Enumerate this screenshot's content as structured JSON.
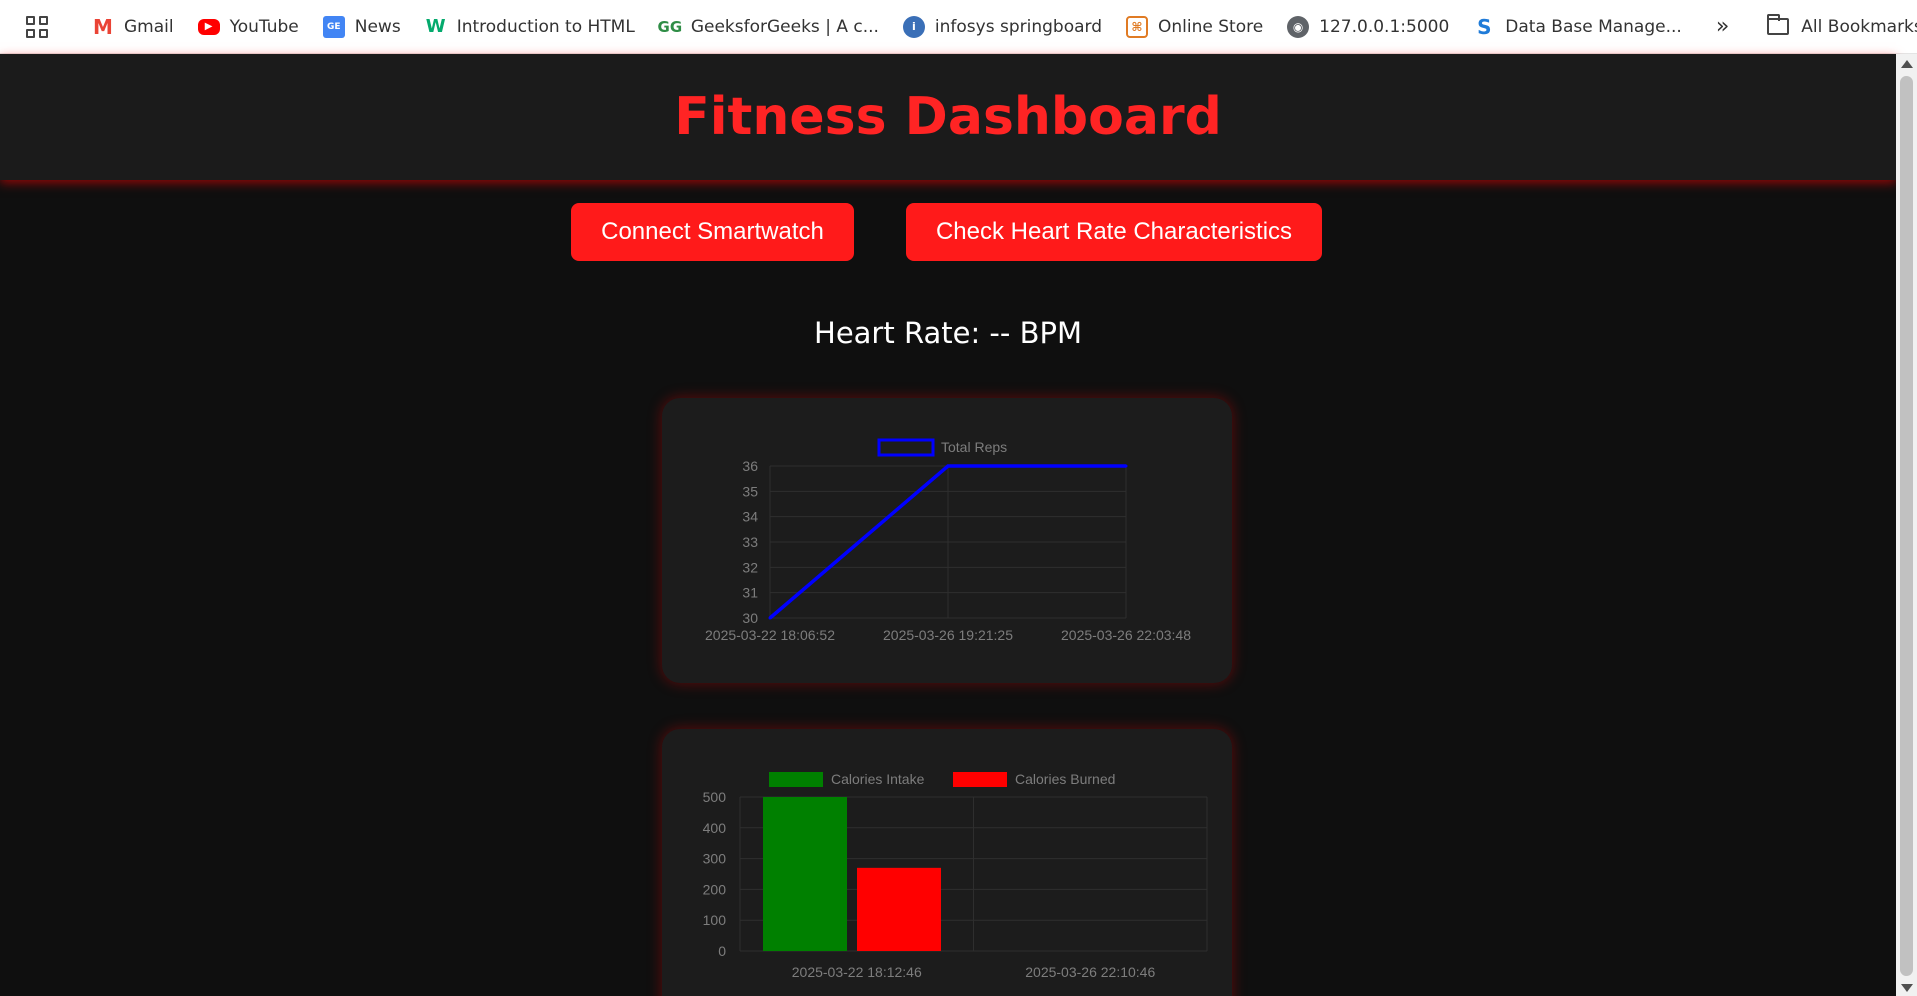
{
  "bookmarks": {
    "items": [
      {
        "label": "Gmail",
        "icon": "gmail-icon",
        "glyph": "M"
      },
      {
        "label": "YouTube",
        "icon": "youtube-icon",
        "glyph": "▶"
      },
      {
        "label": "News",
        "icon": "google-news-icon",
        "glyph": "GE"
      },
      {
        "label": "Introduction to HTML",
        "icon": "w3schools-icon",
        "glyph": "W"
      },
      {
        "label": "GeeksforGeeks | A c...",
        "icon": "geeksforgeeks-icon",
        "glyph": "GG"
      },
      {
        "label": "infosys springboard",
        "icon": "infosys-icon",
        "glyph": "i"
      },
      {
        "label": "Online Store",
        "icon": "store-icon",
        "glyph": "⌘"
      },
      {
        "label": "127.0.0.1:5000",
        "icon": "globe-icon",
        "glyph": "◉"
      },
      {
        "label": "Data Base Manage...",
        "icon": "s-logo-icon",
        "glyph": "S"
      }
    ],
    "more": "»",
    "all_bookmarks": "All Bookmarks"
  },
  "header": {
    "title": "Fitness Dashboard"
  },
  "buttons": {
    "connect": "Connect Smartwatch",
    "heart": "Check Heart Rate Characteristics"
  },
  "heart_rate": {
    "text": "Heart Rate: -- BPM"
  },
  "colors": {
    "accent": "#ff1a1a",
    "reps_line": "#0000ff",
    "intake": "#008000",
    "burned": "#ff0000"
  },
  "chart_data": [
    {
      "type": "line",
      "x": [
        "2025-03-22 18:06:52",
        "2025-03-26 19:21:25",
        "2025-03-26 22:03:48"
      ],
      "series": [
        {
          "name": "Total Reps",
          "values": [
            30,
            36,
            36
          ]
        }
      ],
      "yticks": [
        30,
        31,
        32,
        33,
        34,
        35,
        36
      ],
      "ylim": [
        30,
        36
      ],
      "legend": "top-center",
      "grid": true
    },
    {
      "type": "bar",
      "categories": [
        "2025-03-22 18:12:46",
        "2025-03-26 22:10:46"
      ],
      "series": [
        {
          "name": "Calories Intake",
          "values": [
            500,
            0
          ]
        },
        {
          "name": "Calories Burned",
          "values": [
            270,
            0
          ]
        }
      ],
      "yticks": [
        0,
        100,
        200,
        300,
        400,
        500
      ],
      "ylim": [
        0,
        500
      ],
      "legend": "top-center",
      "grid": true
    }
  ]
}
